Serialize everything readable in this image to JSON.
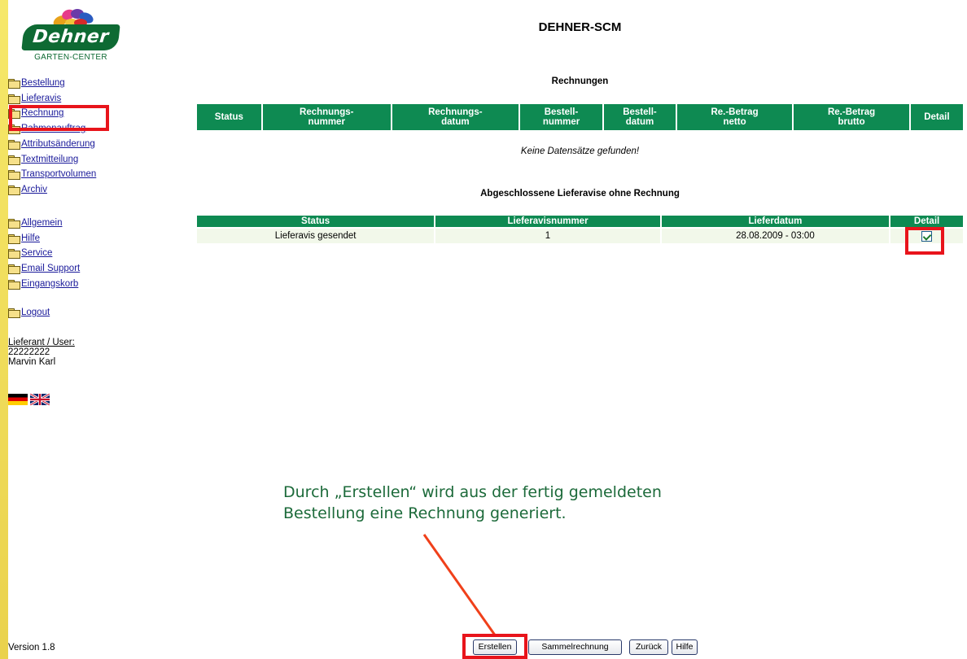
{
  "app": {
    "title": "DEHNER-SCM",
    "logo_text": "Dehner",
    "logo_subtitle": "GARTEN-CENTER"
  },
  "sidebar": {
    "nav_groups": [
      [
        "Bestellung",
        "Lieferavis",
        "Rechnung",
        "Rahmenauftrag",
        "Attributsänderung",
        "Textmitteilung",
        "Transportvolumen",
        "Archiv"
      ],
      [
        "Allgemein",
        "Hilfe",
        "Service",
        "Email Support",
        "Eingangskorb"
      ],
      [
        "Logout"
      ]
    ],
    "user": {
      "label": "Lieferant / User:",
      "id": "22222222",
      "name": "Marvin Karl"
    },
    "languages": [
      "de-flag-icon",
      "uk-flag-icon"
    ],
    "version": "Version 1.8"
  },
  "invoices": {
    "title": "Rechnungen",
    "columns": [
      "Status",
      "Rechnungs-\nnummer",
      "Rechnungs-\ndatum",
      "Bestell-\nnummer",
      "Bestell-\ndatum",
      "Re.-Betrag\nnetto",
      "Re.-Betrag\nbrutto",
      "Detail"
    ],
    "empty_message": "Keine Datensätze gefunden!"
  },
  "closed_avis": {
    "title": "Abgeschlossene Lieferavise ohne Rechnung",
    "columns": [
      "Status",
      "Lieferavisnummer",
      "Lieferdatum",
      "Detail"
    ],
    "rows": [
      {
        "status": "Lieferavis gesendet",
        "number": "1",
        "date": "28.08.2009 - 03:00",
        "detail_checked": true
      }
    ]
  },
  "annotation": {
    "text": "Durch „Erstellen“ wird aus der fertig gemeldeten Bestellung eine Rechnung generiert.",
    "color": "#1c6a3a",
    "highlight_color": "#e8141b"
  },
  "buttons": {
    "create": "Erstellen",
    "collective": "Sammelrechnung",
    "back": "Zurück",
    "help": "Hilfe"
  },
  "colors": {
    "header_green": "#0e8a52",
    "row_bg": "#f2f8ea",
    "link": "#1a1a9a"
  }
}
